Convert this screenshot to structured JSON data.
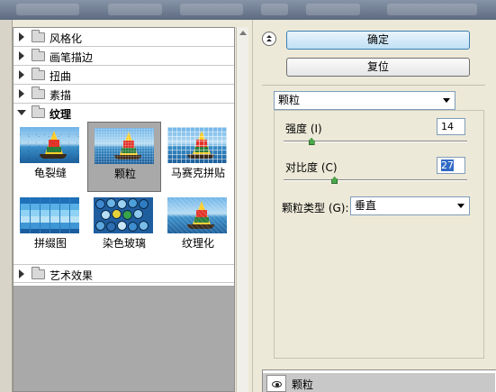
{
  "tree": {
    "categories": [
      {
        "label": "风格化",
        "expanded": false
      },
      {
        "label": "画笔描边",
        "expanded": false
      },
      {
        "label": "扭曲",
        "expanded": false
      },
      {
        "label": "素描",
        "expanded": false
      },
      {
        "label": "纹理",
        "expanded": true
      },
      {
        "label": "艺术效果",
        "expanded": false
      }
    ],
    "filters": [
      {
        "label": "龟裂缝",
        "selected": false
      },
      {
        "label": "颗粒",
        "selected": true
      },
      {
        "label": "马赛克拼贴",
        "selected": false
      },
      {
        "label": "拼缀图",
        "selected": false
      },
      {
        "label": "染色玻璃",
        "selected": false
      },
      {
        "label": "纹理化",
        "selected": false
      }
    ]
  },
  "buttons": {
    "ok": "确定",
    "reset": "复位"
  },
  "filter_select": {
    "value": "颗粒"
  },
  "params": {
    "intensity": {
      "label": "强度 (I)",
      "value": "14",
      "level": 14
    },
    "contrast": {
      "label": "对比度 (C)",
      "value": "27",
      "level": 27
    },
    "grain_type": {
      "label": "颗粒类型 (G):",
      "value": "垂直"
    }
  },
  "layers": {
    "items": [
      {
        "label": "颗粒",
        "visible": true
      }
    ]
  },
  "colors": {
    "selected_thumb_bg": "#a9a9a9",
    "primary_button": "#bfe0f5",
    "slider_thumb": "#4aa84a",
    "text_selection": "#316ac5"
  },
  "icons": {
    "category_folder": "folder-icon",
    "expand": "triangle-right-icon",
    "collapse": "triangle-down-icon",
    "visibility": "eye-icon",
    "panel_collapse": "double-chevron-up-icon"
  }
}
